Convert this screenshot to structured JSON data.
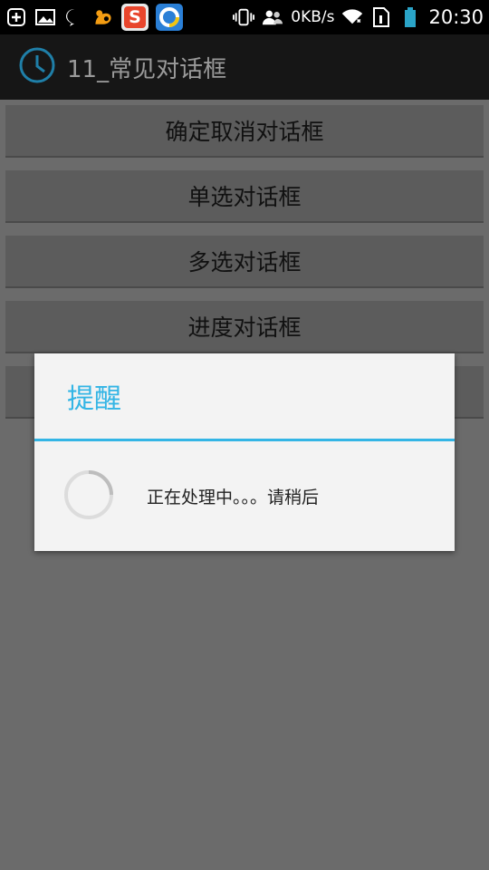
{
  "statusbar": {
    "network_speed": "0KB/s",
    "time": "20:30",
    "notif_app_s": "S"
  },
  "actionbar": {
    "title": "11_常见对话框",
    "icon": "clock-icon"
  },
  "buttons": [
    {
      "label": "确定取消对话框"
    },
    {
      "label": "单选对话框"
    },
    {
      "label": "多选对话框"
    },
    {
      "label": "进度对话框"
    }
  ],
  "dialog": {
    "title": "提醒",
    "message": "正在处理中。。。请稍后",
    "accent_color": "#33b5e5"
  }
}
